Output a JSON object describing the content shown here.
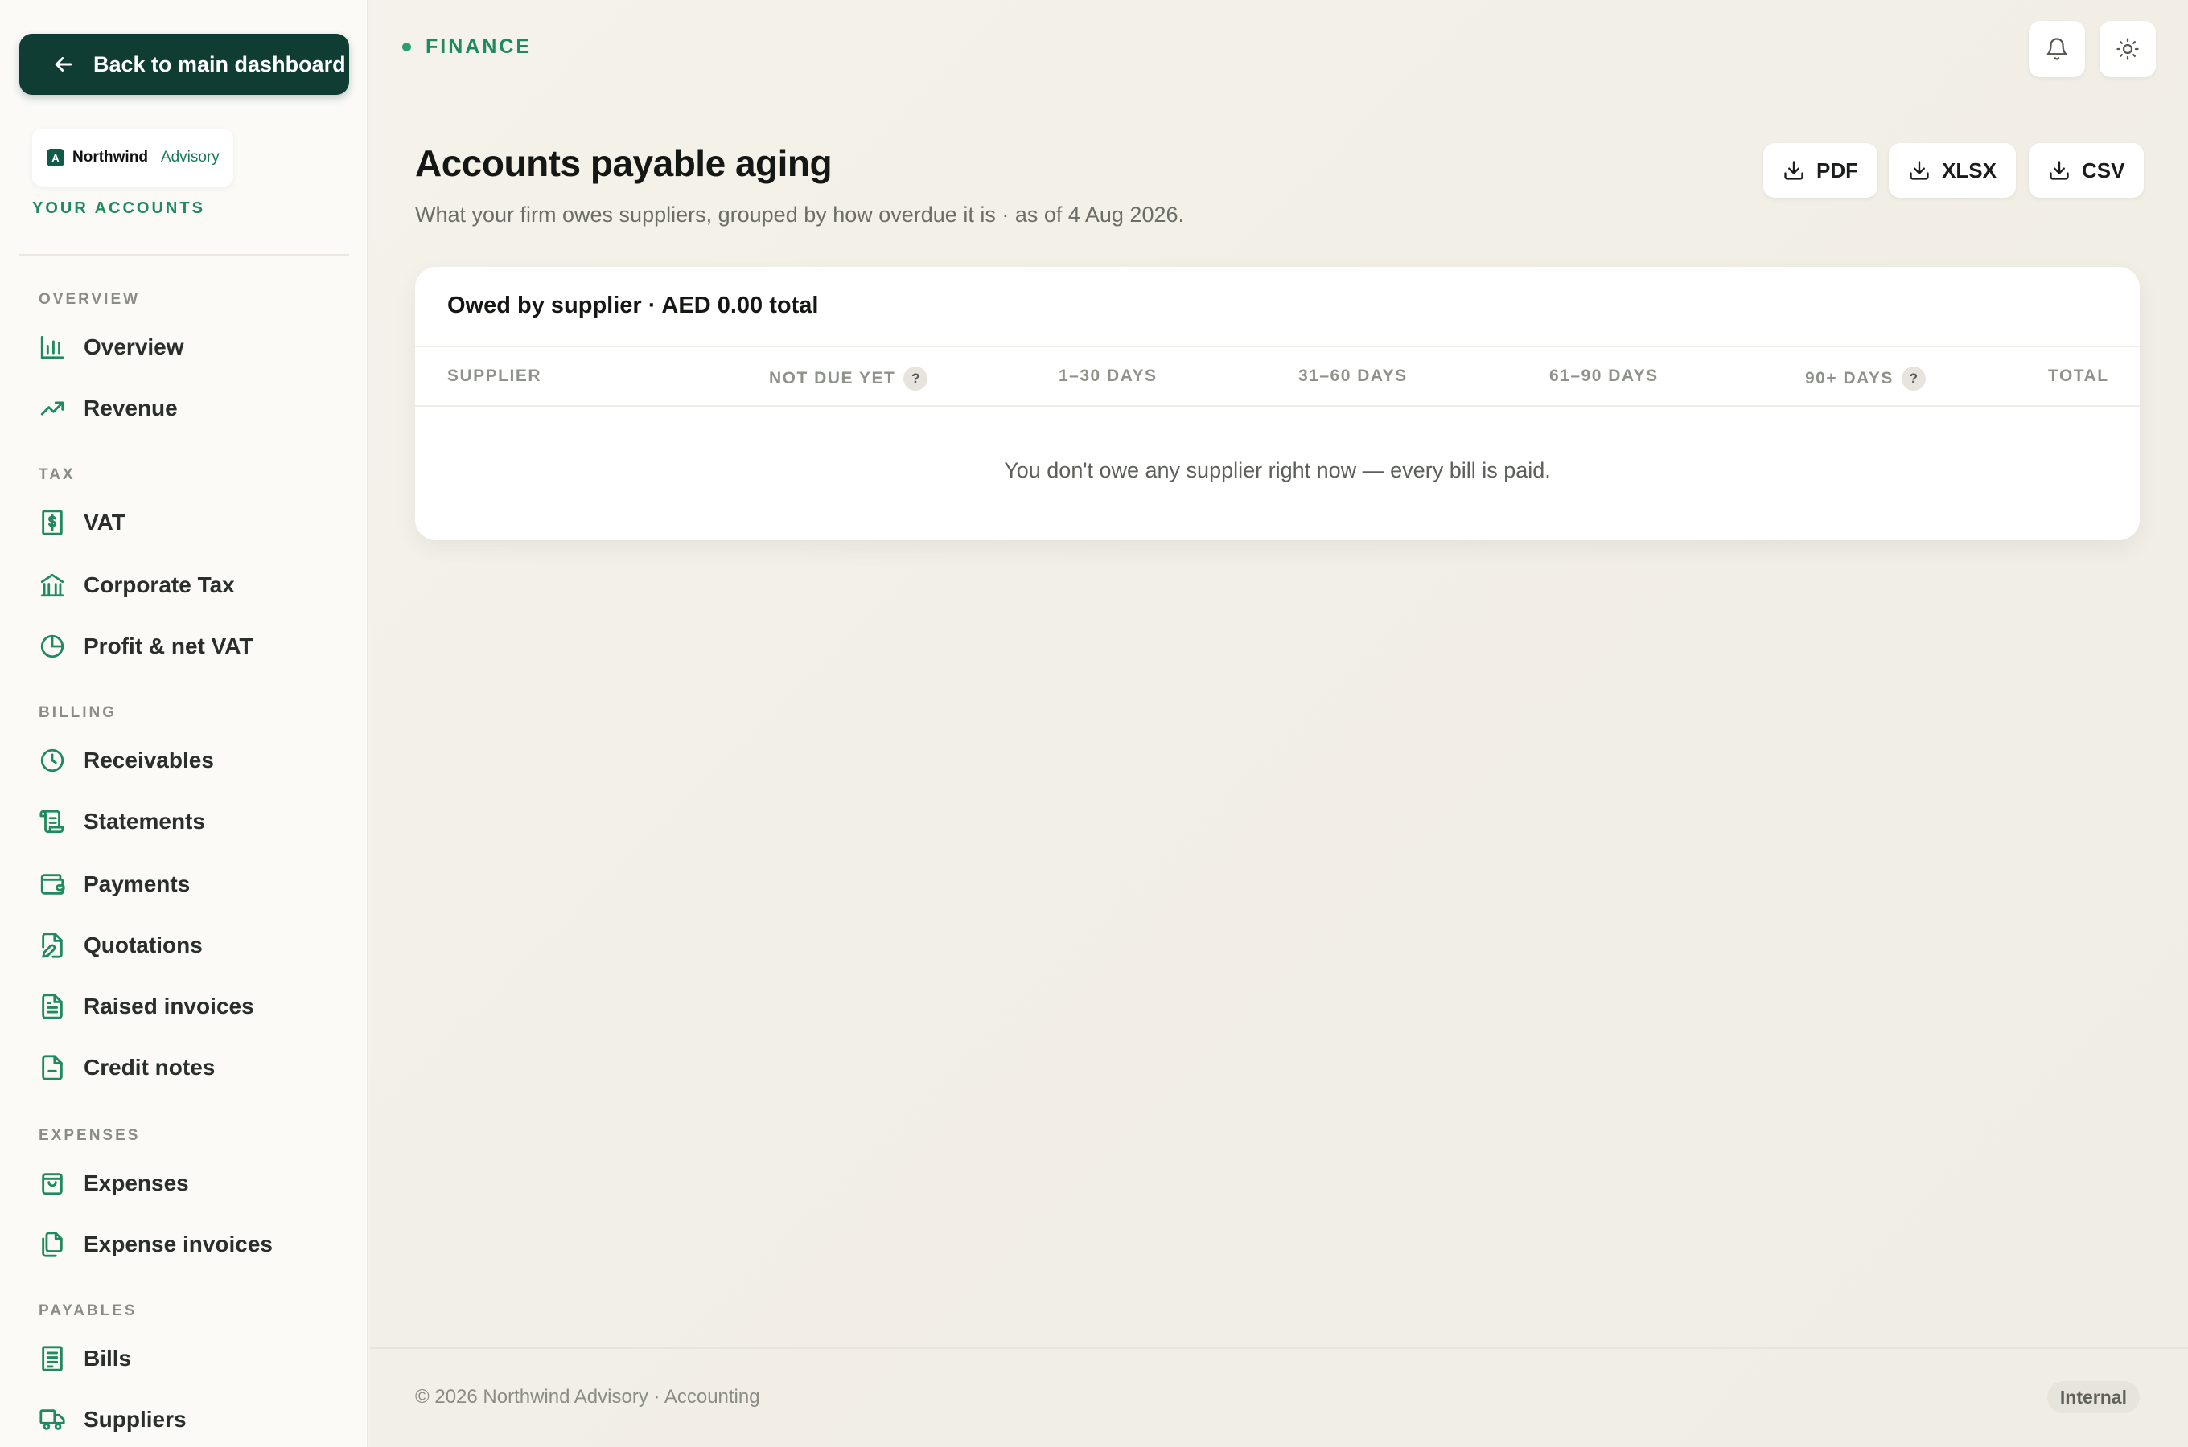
{
  "sidebar": {
    "back_label": "Back to main dashboard",
    "brand": {
      "mark": "A",
      "name": "Northwind",
      "sub": "Advisory"
    },
    "your_accounts": "YOUR ACCOUNTS",
    "sections": {
      "overview": "OVERVIEW",
      "tax": "TAX",
      "billing": "BILLING",
      "expenses": "EXPENSES",
      "payables": "PAYABLES"
    },
    "items": {
      "overview": "Overview",
      "revenue": "Revenue",
      "vat": "VAT",
      "corporate_tax": "Corporate Tax",
      "profit_net_vat": "Profit & net VAT",
      "receivables": "Receivables",
      "statements": "Statements",
      "payments": "Payments",
      "quotations": "Quotations",
      "raised_invoices": "Raised invoices",
      "credit_notes": "Credit notes",
      "expenses": "Expenses",
      "expense_invoices": "Expense invoices",
      "bills": "Bills",
      "suppliers": "Suppliers"
    }
  },
  "header": {
    "breadcrumb": "FINANCE",
    "notification_icon": "bell-icon",
    "theme_icon": "sun-icon"
  },
  "page": {
    "title": "Accounts payable aging",
    "subtitle": "What your firm owes suppliers, grouped by how overdue it is · as of 4 Aug 2026.",
    "exports": {
      "pdf": "PDF",
      "xlsx": "XLSX",
      "csv": "CSV"
    }
  },
  "table": {
    "title": "Owed by supplier · AED 0.00 total",
    "columns": {
      "supplier": "SUPPLIER",
      "not_due": "NOT DUE YET",
      "d1_30": "1–30 DAYS",
      "d31_60": "31–60 DAYS",
      "d61_90": "61–90 DAYS",
      "d90_plus": "90+ DAYS",
      "total": "TOTAL"
    },
    "help_glyph": "?",
    "empty_message": "You don't owe any supplier right now — every bill is paid."
  },
  "footer": {
    "copyright": "© 2026 Northwind Advisory · Accounting",
    "badge": "Internal"
  },
  "colors": {
    "accent": "#1f8a5e",
    "primary_button": "#0f3d33",
    "background": "#f3f1ea"
  }
}
